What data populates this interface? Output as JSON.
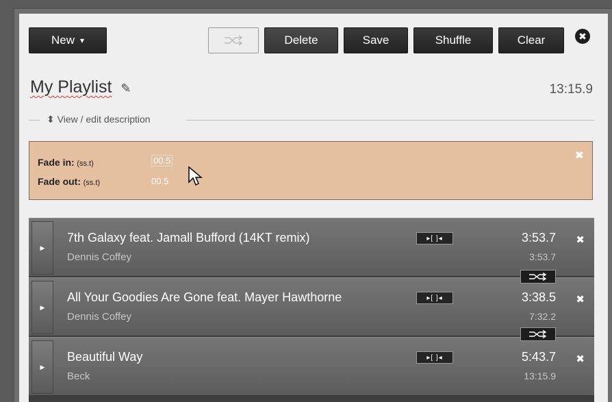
{
  "toolbar": {
    "new_label": "New",
    "new_caret": "▾",
    "shuffle_toggle_icon": "shuffle-icon",
    "delete_label": "Delete",
    "save_label": "Save",
    "shuffle_label": "Shuffle",
    "clear_label": "Clear",
    "close_icon": "✖"
  },
  "playlist": {
    "title": "My Playlist",
    "total_duration": "13:15.9",
    "description_toggle": "⬍ View / edit description"
  },
  "fade": {
    "fade_in_label": "Fade in:",
    "fade_in_unit": "(ss.t)",
    "fade_in_value": "00.5",
    "fade_out_label": "Fade out:",
    "fade_out_unit": "(ss.t)",
    "fade_out_value": "00.5"
  },
  "tracks": [
    {
      "title": "7th Galaxy feat. Jamall Bufford (14KT remix)",
      "artist": "Dennis Coffey",
      "duration": "3:53.7",
      "cumulative": "3:53.7"
    },
    {
      "title": "All Your Goodies Are Gone feat. Mayer Hawthorne",
      "artist": "Dennis Coffey",
      "duration": "3:38.5",
      "cumulative": "7:32.2"
    },
    {
      "title": "Beautiful Way",
      "artist": "Beck",
      "duration": "5:43.7",
      "cumulative": "13:15.9"
    }
  ],
  "colors": {
    "fade_panel": "#e4bfa0",
    "track_bg": "#6a6a6a",
    "button_dark": "#2a2a2a"
  }
}
